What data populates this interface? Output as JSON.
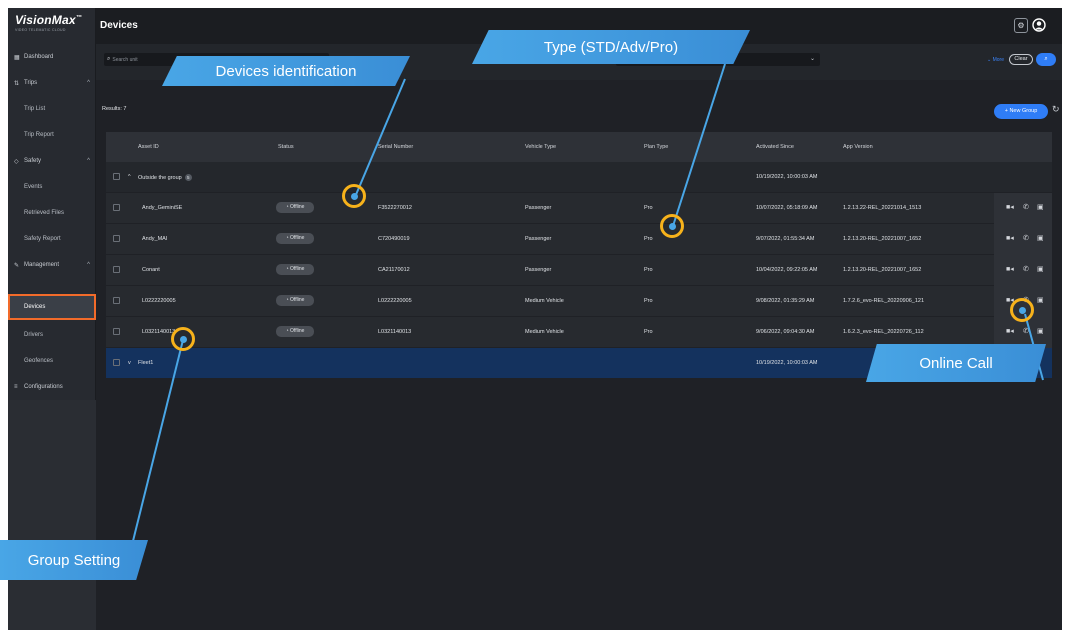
{
  "app": {
    "logo": "VisionMax",
    "logo_mark": "™",
    "tagline": "VIDEO TELEMATIC CLOUD",
    "page_title": "Devices"
  },
  "sidebar": {
    "items": [
      {
        "label": "Dashboard",
        "icon": "dashboard-icon"
      },
      {
        "label": "Trips",
        "icon": "trips-icon"
      },
      {
        "label": "Trip List"
      },
      {
        "label": "Trip Report"
      },
      {
        "label": "Safety",
        "icon": "shield-icon"
      },
      {
        "label": "Events"
      },
      {
        "label": "Retrieved Files"
      },
      {
        "label": "Safety Report"
      },
      {
        "label": "Management",
        "icon": "wrench-icon"
      },
      {
        "label": "Devices",
        "active": true
      },
      {
        "label": "Drivers"
      },
      {
        "label": "Geofences"
      },
      {
        "label": "Configurations",
        "icon": "sliders-icon"
      }
    ]
  },
  "filters": {
    "search_placeholder": "Search unit",
    "more_label": "More",
    "clear_label": "Clear"
  },
  "results_label": "Results: 7",
  "new_group_label": "New Group",
  "table": {
    "columns": [
      "Asset ID",
      "Status",
      "Serial Number",
      "Vehicle Type",
      "Plan Type",
      "Activated Since",
      "App Version"
    ],
    "groups": [
      {
        "name": "Outside the group",
        "count": "5",
        "activated": "10/19/2022, 10:00:03 AM"
      },
      {
        "name": "Fleet1",
        "activated": "10/19/2022, 10:00:03 AM"
      }
    ],
    "rows": [
      {
        "asset_id": "Andy_GeminiSE",
        "status": "Offline",
        "serial": "F3522270012",
        "vehicle": "Passenger",
        "plan": "Pro",
        "activated": "10/07/2022, 05:18:09 AM",
        "version": "1.2.13.22-REL_20221014_1513"
      },
      {
        "asset_id": "Andy_MAI",
        "status": "Offline",
        "serial": "C720490019",
        "vehicle": "Passenger",
        "plan": "Pro",
        "activated": "9/07/2022, 01:55:34 AM",
        "version": "1.2.13.20-REL_20221007_1652"
      },
      {
        "asset_id": "Conant",
        "status": "Offline",
        "serial": "CA21170012",
        "vehicle": "Passenger",
        "plan": "Pro",
        "activated": "10/04/2022, 09:22:05 AM",
        "version": "1.2.13.20-REL_20221007_1652"
      },
      {
        "asset_id": "L0222220005",
        "status": "Offline",
        "serial": "L0222220005",
        "vehicle": "Medium Vehicle",
        "plan": "Pro",
        "activated": "9/08/2022, 01:35:29 AM",
        "version": "1.7.2.6_evo-REL_20220906_121"
      },
      {
        "asset_id": "L0321140013",
        "status": "Offline",
        "serial": "L0321140013",
        "vehicle": "Medium Vehicle",
        "plan": "Pro",
        "activated": "9/06/2022, 09:04:30 AM",
        "version": "1.6.2.3_evo-REL_20220726_112"
      }
    ]
  },
  "annotations": {
    "devices_identification": "Devices identification",
    "type": "Type (STD/Adv/Pro)",
    "online_call": "Online Call",
    "group_setting": "Group Setting"
  },
  "colors": {
    "accent": "#2f7df6",
    "callout": "#49a6e6",
    "ring": "#f7b21b",
    "active_outline": "#f26b2a"
  }
}
